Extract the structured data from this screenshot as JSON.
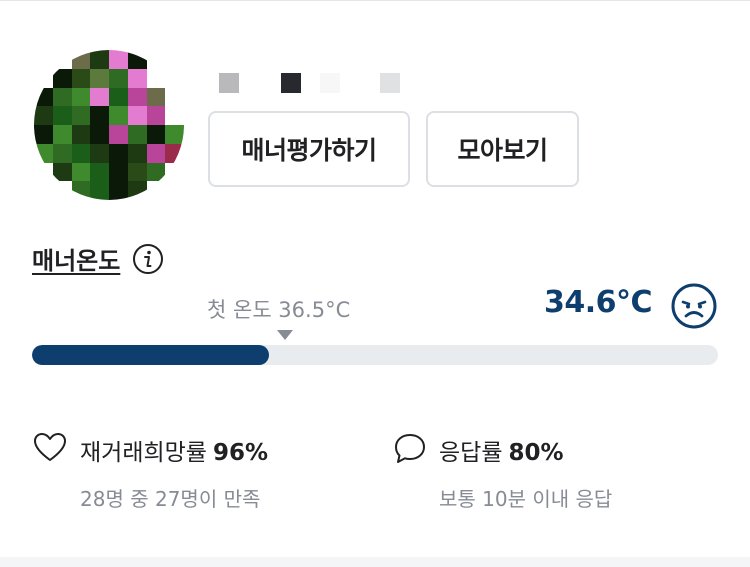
{
  "profile": {
    "avatar_alt": "profile-avatar",
    "buttons": {
      "rate_manner": "매너평가하기",
      "view_all": "모아보기"
    }
  },
  "manner": {
    "title": "매너온도",
    "first_temperature_label": "첫 온도 36.5°C",
    "current_temperature": "34.6°C",
    "progress_fraction": 0.346,
    "colors": {
      "accent": "#0e3e6e",
      "track": "#e9ecef",
      "muted": "#868b94"
    }
  },
  "stats": {
    "rebuy": {
      "label": "재거래희망률",
      "value": "96%",
      "sub": "28명 중 27명이 만족",
      "icon": "heart-icon"
    },
    "response": {
      "label": "응답률",
      "value": "80%",
      "sub": "보통 10분 이내 응답",
      "icon": "speech-bubble-icon"
    }
  }
}
